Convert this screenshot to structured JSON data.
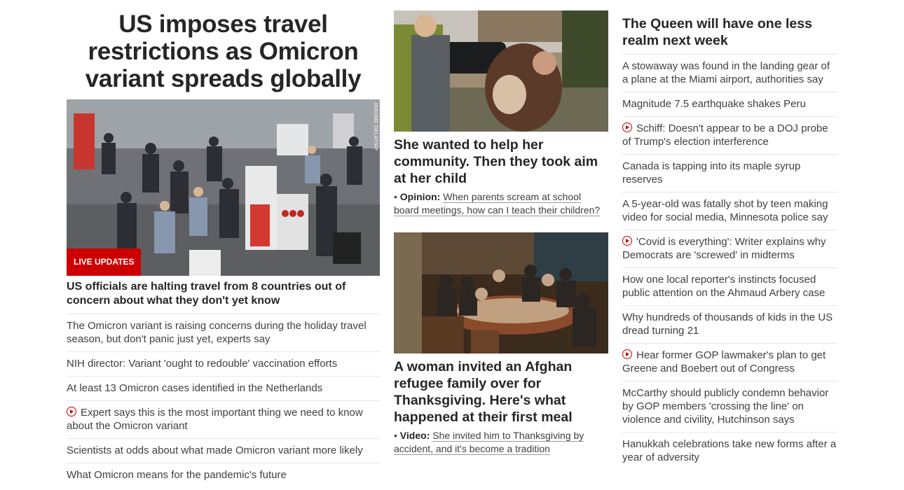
{
  "col1": {
    "headline": "US imposes travel restrictions as Omicron variant spreads globally",
    "badge": "LIVE UPDATES",
    "photo_credit": "JEROME DELAY/AP",
    "lead_link": "US officials are halting travel from 8 countries out of concern about what they don't yet know",
    "items": [
      {
        "text": "The Omicron variant is raising concerns during the holiday travel season, but don't panic just yet, experts say",
        "video": false
      },
      {
        "text": "NIH director: Variant 'ought to redouble' vaccination efforts",
        "video": false
      },
      {
        "text": "At least 13 Omicron cases identified in the Netherlands",
        "video": false
      },
      {
        "text": "Expert says this is the most important thing we need to know about the Omicron variant",
        "video": true
      },
      {
        "text": "Scientists at odds about what made Omicron variant more likely",
        "video": false
      },
      {
        "text": "What Omicron means for the pandemic's future",
        "video": false
      }
    ]
  },
  "col2": {
    "story1": {
      "headline": "She wanted to help her community. Then they took aim at her child",
      "kicker": "Opinion:",
      "sub": "When parents scream at school board meetings, how can I teach their children?"
    },
    "story2": {
      "headline": "A woman invited an Afghan refugee family over for Thanksgiving. Here's what happened at their first meal",
      "kicker": "Video:",
      "sub": "She invited him to Thanksgiving by accident, and it's become a tradition"
    }
  },
  "col3": {
    "headline": "The Queen will have one less realm next week",
    "items": [
      {
        "text": "A stowaway was found in the landing gear of a plane at the Miami airport, authorities say",
        "video": false
      },
      {
        "text": "Magnitude 7.5 earthquake shakes Peru",
        "video": false
      },
      {
        "text": "Schiff: Doesn't appear to be a DOJ probe of Trump's election interference",
        "video": true
      },
      {
        "text": "Canada is tapping into its maple syrup reserves",
        "video": false
      },
      {
        "text": "A 5-year-old was fatally shot by teen making video for social media, Minnesota police say",
        "video": false
      },
      {
        "text": "'Covid is everything': Writer explains why Democrats are 'screwed' in midterms",
        "video": true
      },
      {
        "text": "How one local reporter's instincts focused public attention on the Ahmaud Arbery case",
        "video": false
      },
      {
        "text": "Why hundreds of thousands of kids in the US dread turning 21",
        "video": false
      },
      {
        "text": "Hear former GOP lawmaker's plan to get Greene and Boebert out of Congress",
        "video": true
      },
      {
        "text": "McCarthy should publicly condemn behavior by GOP members 'crossing the line' on violence and civility, Hutchinson says",
        "video": false
      },
      {
        "text": "Hanukkah celebrations take new forms after a year of adversity",
        "video": false
      }
    ]
  },
  "colors": {
    "accent": "#cc0000",
    "text": "#262626",
    "divider": "#e6e6e6"
  }
}
